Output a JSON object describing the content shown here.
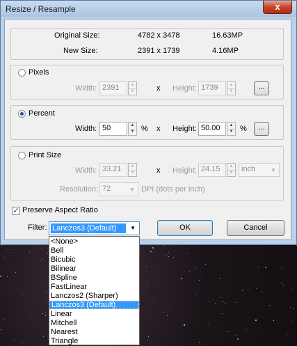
{
  "window": {
    "title": "Resize / Resample",
    "close_label": "x"
  },
  "info": {
    "original_label": "Original Size:",
    "original_dims": "4782 x 3478",
    "original_mp": "16.63MP",
    "new_label": "New Size:",
    "new_dims": "2391 x 1739",
    "new_mp": "4.16MP"
  },
  "pixels": {
    "label": "Pixels",
    "width_label": "Width:",
    "width_value": "2391",
    "x_label": "x",
    "height_label": "Height:",
    "height_value": "1739",
    "dots_label": "..."
  },
  "percent": {
    "label": "Percent",
    "width_label": "Width:",
    "width_value": "50",
    "unit1": "%",
    "x_label": "x",
    "height_label": "Height:",
    "height_value": "50.00",
    "unit2": "%",
    "dots_label": "..."
  },
  "print_size": {
    "label": "Print Size",
    "width_label": "Width:",
    "width_value": "33.21",
    "x_label": "x",
    "height_label": "Height:",
    "height_value": "24.15",
    "unit_value": "inch",
    "resolution_label": "Resolution:",
    "resolution_value": "72",
    "dpi_label": "DPI (dots per inch)"
  },
  "preserve": {
    "label": "Preserve Aspect Ratio",
    "checked": true,
    "check_mark": "✓"
  },
  "filter": {
    "label": "Filter:",
    "selected": "Lanczos3 (Default)",
    "options": [
      "<None>",
      "Bell",
      "Bicubic",
      "Bilinear",
      "BSpline",
      "FastLinear",
      "Lanczos2 (Sharper)",
      "Lanczos3 (Default)",
      "Linear",
      "Mitchell",
      "Nearest",
      "Triangle"
    ]
  },
  "buttons": {
    "ok": "OK",
    "cancel": "Cancel"
  }
}
